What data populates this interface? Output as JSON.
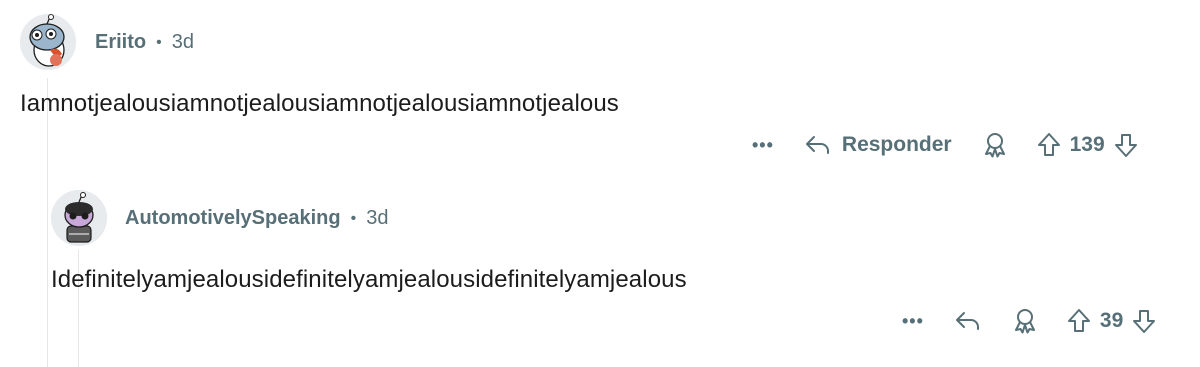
{
  "comments": [
    {
      "author": "Eriito",
      "time": "3d",
      "text": "Iamnotjealousiamnotjealousiamnotjealousiamnotjealous",
      "more_label": "•••",
      "reply_label": "Responder",
      "score": "139",
      "icons": {
        "more": "more-options-icon",
        "reply": "reply-arrow-icon",
        "award": "award-icon",
        "upvote": "upvote-arrow-icon",
        "downvote": "downvote-arrow-icon"
      }
    },
    {
      "author": "AutomotivelySpeaking",
      "time": "3d",
      "text": "Idefinitelyamjealousidefinitelyamjealousidefinitelyamjealous",
      "more_label": "•••",
      "score": "39",
      "icons": {
        "more": "more-options-icon",
        "reply": "reply-arrow-icon",
        "award": "award-icon",
        "upvote": "upvote-arrow-icon",
        "downvote": "downvote-arrow-icon"
      }
    }
  ],
  "meta_separator": "•",
  "colors": {
    "meta": "#576f76",
    "text": "#1c1c1c",
    "thread_line": "#e5e7e9"
  }
}
